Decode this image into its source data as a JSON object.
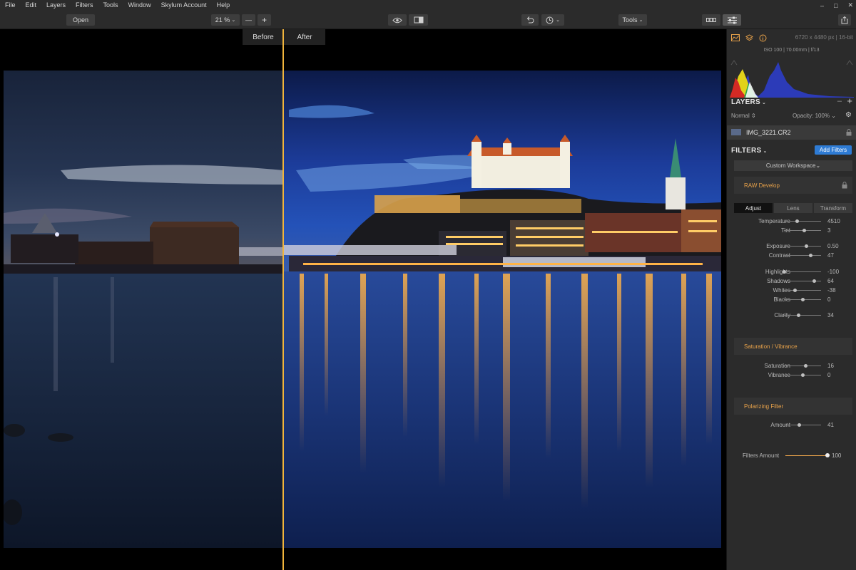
{
  "menu": [
    "File",
    "Edit",
    "Layers",
    "Filters",
    "Tools",
    "Window",
    "Skylum Account",
    "Help"
  ],
  "window_controls": [
    "–",
    "□",
    "✕"
  ],
  "toolbar": {
    "open_label": "Open",
    "zoom_value": "21 %",
    "zoom_minus": "—",
    "zoom_plus": "+",
    "tools_label": "Tools"
  },
  "compare": {
    "before": "Before",
    "after": "After"
  },
  "panel": {
    "image_info": "6720 x 4480 px | 16-bit",
    "exif": "ISO 100 | 70.00mm | f/13",
    "layers": {
      "title": "LAYERS",
      "blend_mode": "Normal",
      "opacity_label": "Opacity: 100%",
      "layer_name": "IMG_3221.CR2"
    },
    "filters": {
      "title": "FILTERS",
      "add_button": "Add Filters",
      "workspace": "Custom Workspace"
    },
    "raw": {
      "title": "RAW Develop",
      "tabs": [
        "Adjust",
        "Lens",
        "Transform"
      ],
      "sliders": [
        {
          "label": "Temperature",
          "value": "4510",
          "pos": 0.35
        },
        {
          "label": "Tint",
          "value": "3",
          "pos": 0.55
        },
        {
          "label": "Exposure",
          "value": "0.50",
          "pos": 0.6
        },
        {
          "label": "Contrast",
          "value": "47",
          "pos": 0.72
        },
        {
          "label": "Highlights",
          "value": "-100",
          "pos": 0.0
        },
        {
          "label": "Shadows",
          "value": "64",
          "pos": 0.82
        },
        {
          "label": "Whites",
          "value": "-38",
          "pos": 0.3
        },
        {
          "label": "Blacks",
          "value": "0",
          "pos": 0.5
        },
        {
          "label": "Clarity",
          "value": "34",
          "pos": 0.4
        }
      ]
    },
    "saturation": {
      "title": "Saturation / Vibrance",
      "sliders": [
        {
          "label": "Saturation",
          "value": "16",
          "pos": 0.58
        },
        {
          "label": "Vibrance",
          "value": "0",
          "pos": 0.5
        }
      ]
    },
    "polarizing": {
      "title": "Polarizing Filter",
      "sliders": [
        {
          "label": "Amount",
          "value": "41",
          "pos": 0.41
        }
      ]
    },
    "filters_amount": {
      "label": "Filters Amount",
      "value": "100",
      "pos": 1.0
    }
  },
  "colors": {
    "accent": "#e8a24a",
    "split_line": "#f0b43c",
    "add_filters_bg": "#2e7bd4",
    "panel_bg": "#2b2b2b"
  }
}
